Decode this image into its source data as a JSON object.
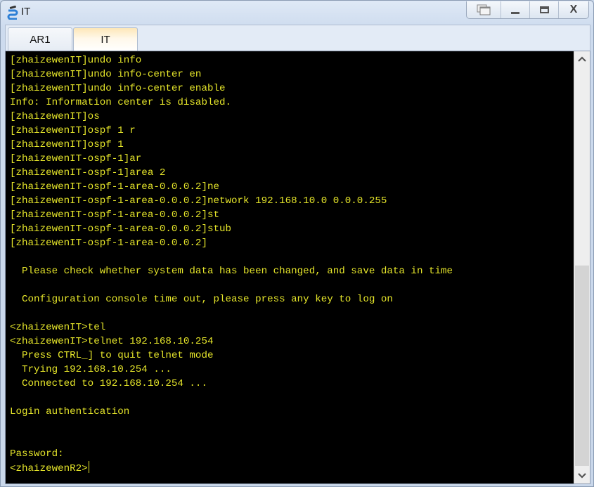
{
  "window": {
    "title": "IT",
    "icon": "network-device-icon",
    "controls": {
      "restore_icon": "restore-window-icon",
      "minimize_label": "–",
      "maximize_label": "▭",
      "close_label": "X"
    }
  },
  "tabs": [
    {
      "label": "AR1",
      "active": false
    },
    {
      "label": "IT",
      "active": true
    }
  ],
  "terminal": {
    "text_color": "#e6e62a",
    "background": "#000000",
    "lines": [
      "[zhaizewenIT]undo info",
      "[zhaizewenIT]undo info-center en",
      "[zhaizewenIT]undo info-center enable",
      "Info: Information center is disabled.",
      "[zhaizewenIT]os",
      "[zhaizewenIT]ospf 1 r",
      "[zhaizewenIT]ospf 1",
      "[zhaizewenIT-ospf-1]ar",
      "[zhaizewenIT-ospf-1]area 2",
      "[zhaizewenIT-ospf-1-area-0.0.0.2]ne",
      "[zhaizewenIT-ospf-1-area-0.0.0.2]network 192.168.10.0 0.0.0.255",
      "[zhaizewenIT-ospf-1-area-0.0.0.2]st",
      "[zhaizewenIT-ospf-1-area-0.0.0.2]stub",
      "[zhaizewenIT-ospf-1-area-0.0.0.2]",
      "",
      "  Please check whether system data has been changed, and save data in time",
      "",
      "  Configuration console time out, please press any key to log on",
      "",
      "<zhaizewenIT>tel",
      "<zhaizewenIT>telnet 192.168.10.254",
      "  Press CTRL_] to quit telnet mode",
      "  Trying 192.168.10.254 ...",
      "  Connected to 192.168.10.254 ...",
      "",
      "Login authentication",
      "",
      "",
      "Password:"
    ],
    "prompt": "<zhaizewenR2>"
  },
  "scrollbar": {
    "position_fraction": 0.53,
    "up_icon": "chevron-up-icon",
    "down_icon": "chevron-down-icon"
  }
}
